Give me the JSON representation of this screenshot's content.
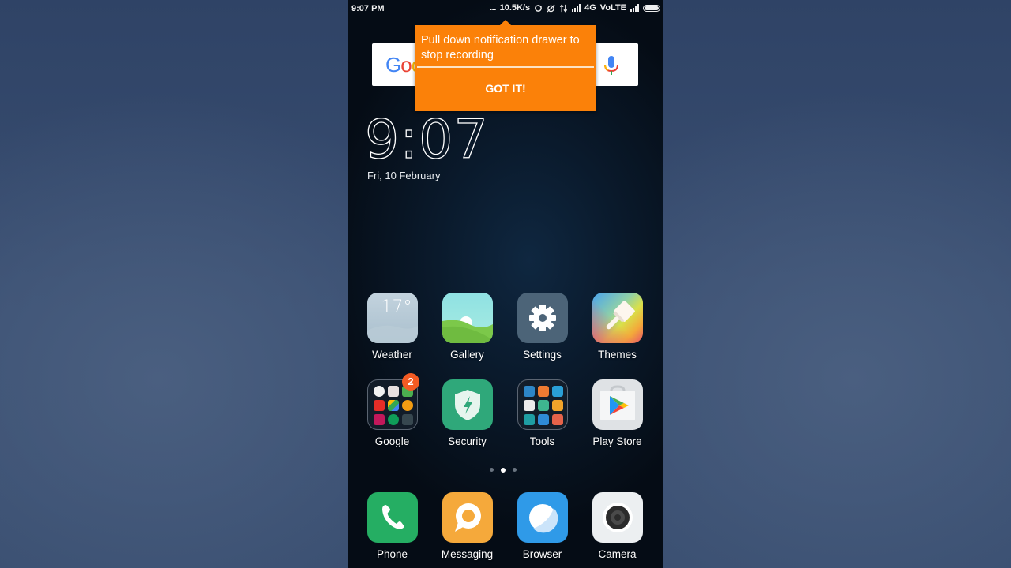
{
  "status_bar": {
    "time": "9:07 PM",
    "more_dots": "...",
    "network_speed": "10.5K/s",
    "network_type": "4G",
    "volte": "VoLTE",
    "icons": [
      "sync-icon",
      "alarm-off-icon",
      "data-transfer-icon",
      "signal-icon",
      "signal-icon",
      "battery-icon"
    ]
  },
  "search_widget": {
    "logo_text": "Goo",
    "logo_colors": [
      "#4285f4",
      "#ea4335",
      "#fbbc05"
    ],
    "mic_icon": "mic-icon"
  },
  "recording_tooltip": {
    "message": "Pull down notification drawer to stop recording",
    "button_label": "GOT IT!",
    "color": "#fb8109"
  },
  "clock": {
    "time": "9:07",
    "date": "Fri, 10 February"
  },
  "weather_widget": {
    "temperature": "17°"
  },
  "apps": [
    {
      "label": "Weather"
    },
    {
      "label": "Gallery"
    },
    {
      "label": "Settings"
    },
    {
      "label": "Themes"
    },
    {
      "label": "Google",
      "badge": "2"
    },
    {
      "label": "Security"
    },
    {
      "label": "Tools"
    },
    {
      "label": "Play Store"
    }
  ],
  "page_indicator": {
    "pages": 3,
    "active_page": 2
  },
  "dock": [
    {
      "label": "Phone"
    },
    {
      "label": "Messaging"
    },
    {
      "label": "Browser"
    },
    {
      "label": "Camera"
    }
  ]
}
